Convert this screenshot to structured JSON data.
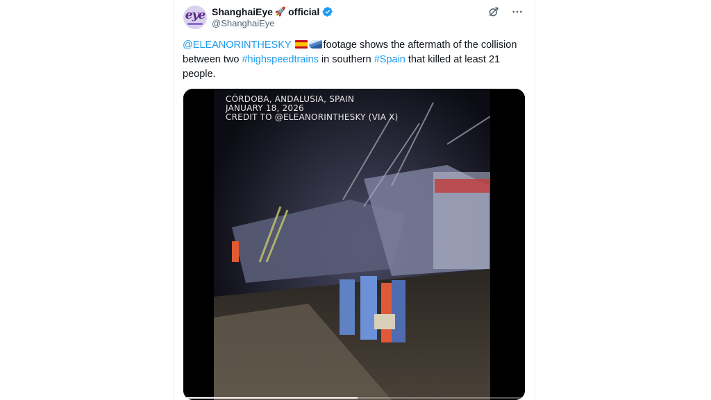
{
  "account": {
    "avatar_text": "eye",
    "display_name": "ShanghaiEye",
    "name_suffix": "official",
    "handle": "@ShanghaiEye",
    "verified": true
  },
  "icons": {
    "grok": "grok-icon",
    "more": "more-icon",
    "verified": "verified-badge-icon",
    "rocket": "rocket-emoji",
    "flag": "spain-flag-emoji",
    "train": "high-speed-train-emoji"
  },
  "tweet": {
    "mention": "@ELEANORINTHESKY",
    "text_1": "footage shows the aftermath of the collision between two ",
    "hashtag_1": "#highspeedtrains",
    "text_2": " in southern ",
    "hashtag_2": "#Spain",
    "text_3": " that killed at least 21 people."
  },
  "video": {
    "caption_line_1": "CÓRDOBA, ANDALUSIA, SPAIN",
    "caption_line_2": "JANUARY 18, 2026",
    "caption_line_3": "CREDIT TO @ELEANORINTHESKY (VIA X)",
    "progress": 0.51
  },
  "colors": {
    "link": "#1d9bf0",
    "verified": "#1d9bf0",
    "text": "#0f1419",
    "secondary": "#536471"
  }
}
